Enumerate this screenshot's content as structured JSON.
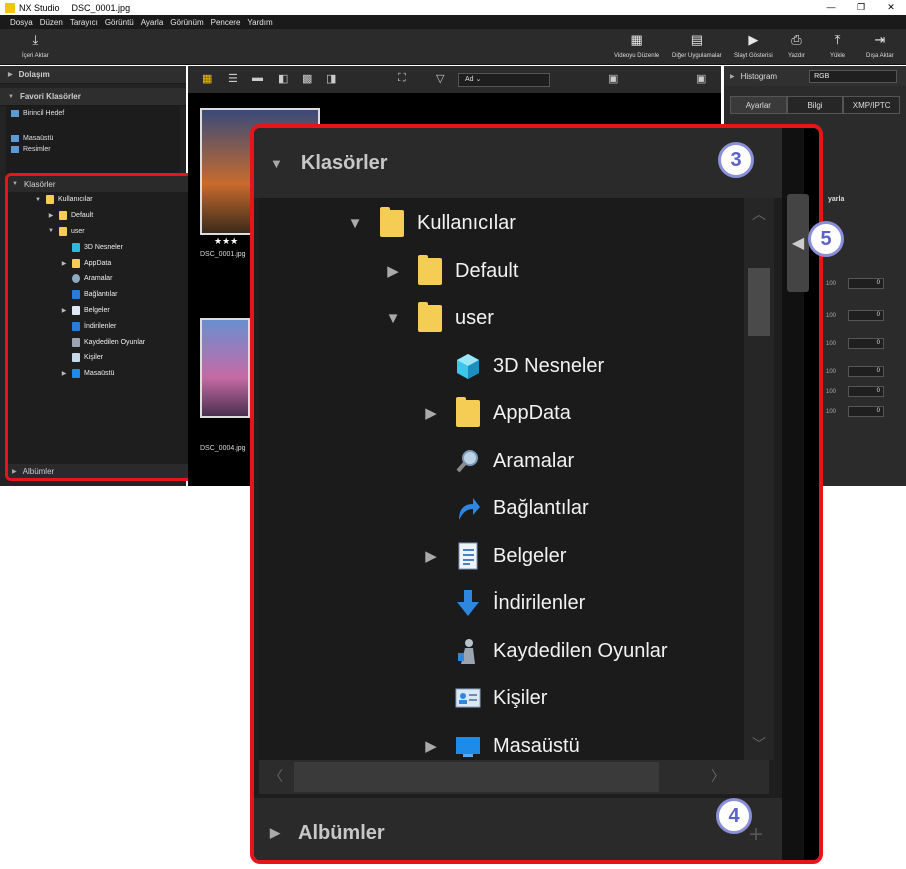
{
  "window": {
    "app_name": "NX Studio",
    "file_name": "DSC_0001.jpg",
    "controls": [
      "—",
      "❐",
      "✕"
    ]
  },
  "menu": [
    "Dosya",
    "Düzen",
    "Tarayıcı",
    "Görüntü",
    "Ayarla",
    "Görünüm",
    "Pencere",
    "Yardım"
  ],
  "toolbar": {
    "import_label": "İçeri Aktar",
    "video_editor_label": "Videoyu Düzenle",
    "other_apps_label": "Diğer Uygulamalar",
    "slideshow_label": "Slayt Gösterisi",
    "print_label": "Yazdır",
    "upload_label": "Yükle",
    "export_label": "Dışa Aktar"
  },
  "left_panel": {
    "navigation_label": "Dolaşım",
    "favorites_label": "Favori Klasörler",
    "favorites": [
      "Birincil Hedef",
      "Masaüstü",
      "Resimler"
    ]
  },
  "folders": {
    "header": "Klasörler",
    "albums_label": "Albümler",
    "tree": [
      {
        "label": "Kullanıcılar",
        "toggle": "▼",
        "icon": "folder-icon",
        "level": 0
      },
      {
        "label": "Default",
        "toggle": "▶",
        "icon": "folder-icon",
        "level": 1
      },
      {
        "label": "user",
        "toggle": "▼",
        "icon": "folder-icon",
        "level": 1
      },
      {
        "label": "3D Nesneler",
        "toggle": "",
        "icon": "3d-objects-icon",
        "level": 2
      },
      {
        "label": "AppData",
        "toggle": "▶",
        "icon": "folder-icon",
        "level": 2
      },
      {
        "label": "Aramalar",
        "toggle": "",
        "icon": "search-icon",
        "level": 2
      },
      {
        "label": "Bağlantılar",
        "toggle": "",
        "icon": "link-icon",
        "level": 2
      },
      {
        "label": "Belgeler",
        "toggle": "▶",
        "icon": "documents-icon",
        "level": 2
      },
      {
        "label": "İndirilenler",
        "toggle": "",
        "icon": "download-icon",
        "level": 2
      },
      {
        "label": "Kaydedilen Oyunlar",
        "toggle": "",
        "icon": "saved-games-icon",
        "level": 2
      },
      {
        "label": "Kişiler",
        "toggle": "",
        "icon": "contacts-icon",
        "level": 2
      },
      {
        "label": "Masaüstü",
        "toggle": "▶",
        "icon": "desktop-icon",
        "level": 2
      }
    ]
  },
  "browser": {
    "sort_label": "Ad",
    "thumbs": [
      {
        "name": "DSC_0001.jpg",
        "stars": "★★★"
      },
      {
        "name": "DSC_0004.jpg",
        "stars": ""
      }
    ]
  },
  "right_panel": {
    "histogram_label": "Histogram",
    "histogram_channel": "RGB",
    "tabs": [
      "Ayarlar",
      "Bilgi",
      "XMP/IPTC"
    ],
    "partial_label": "yarla",
    "slider_values": [
      "0",
      "0",
      "0",
      "0",
      "0",
      "0"
    ],
    "slider_max": "100"
  },
  "callouts": [
    "3",
    "4",
    "5"
  ],
  "colors": {
    "highlight": "#e8141c",
    "callout": "#5b62c8",
    "folder": "#f5cd55"
  }
}
